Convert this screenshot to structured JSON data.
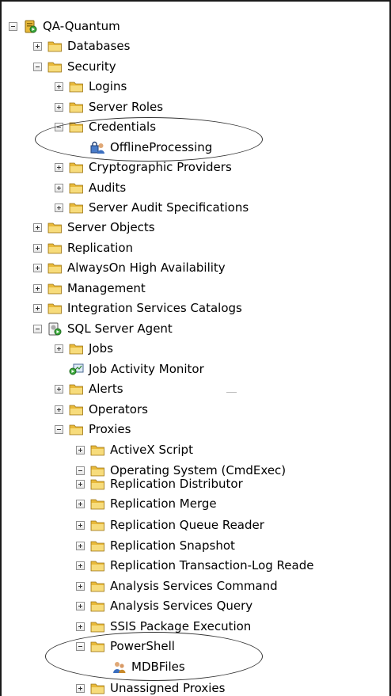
{
  "tree": {
    "root": {
      "label": "QA-Quantum",
      "icon": "server-icon",
      "expanded": true
    },
    "nodes": [
      {
        "id": "databases",
        "label": "Databases",
        "level": 1,
        "toggle": "plus",
        "icon": "folder-icon"
      },
      {
        "id": "security",
        "label": "Security",
        "level": 1,
        "toggle": "minus",
        "icon": "folder-icon"
      },
      {
        "id": "logins",
        "label": "Logins",
        "level": 2,
        "toggle": "plus",
        "icon": "folder-icon"
      },
      {
        "id": "server-roles",
        "label": "Server Roles",
        "level": 2,
        "toggle": "plus",
        "icon": "folder-icon"
      },
      {
        "id": "credentials",
        "label": "Credentials",
        "level": 2,
        "toggle": "minus",
        "icon": "folder-icon"
      },
      {
        "id": "offline-processing",
        "label": "OfflineProcessing",
        "level": 3,
        "toggle": "none",
        "icon": "credential-icon"
      },
      {
        "id": "cryptographic-providers",
        "label": "Cryptographic Providers",
        "level": 2,
        "toggle": "plus",
        "icon": "folder-icon"
      },
      {
        "id": "audits",
        "label": "Audits",
        "level": 2,
        "toggle": "plus",
        "icon": "folder-icon"
      },
      {
        "id": "server-audit-specifications",
        "label": "Server Audit Specifications",
        "level": 2,
        "toggle": "plus",
        "icon": "folder-icon"
      },
      {
        "id": "server-objects",
        "label": "Server Objects",
        "level": 1,
        "toggle": "plus",
        "icon": "folder-icon"
      },
      {
        "id": "replication",
        "label": "Replication",
        "level": 1,
        "toggle": "plus",
        "icon": "folder-icon"
      },
      {
        "id": "alwayson",
        "label": "AlwaysOn High Availability",
        "level": 1,
        "toggle": "plus",
        "icon": "folder-icon"
      },
      {
        "id": "management",
        "label": "Management",
        "level": 1,
        "toggle": "plus",
        "icon": "folder-icon"
      },
      {
        "id": "integration-services-catalogs",
        "label": "Integration Services Catalogs",
        "level": 1,
        "toggle": "plus",
        "icon": "folder-icon"
      },
      {
        "id": "sql-server-agent",
        "label": "SQL Server Agent",
        "level": 1,
        "toggle": "minus",
        "icon": "agent-icon"
      },
      {
        "id": "jobs",
        "label": "Jobs",
        "level": 2,
        "toggle": "plus",
        "icon": "folder-icon"
      },
      {
        "id": "job-activity-monitor",
        "label": "Job Activity Monitor",
        "level": 2,
        "toggle": "none",
        "icon": "monitor-icon"
      },
      {
        "id": "alerts",
        "label": "Alerts",
        "level": 2,
        "toggle": "plus",
        "icon": "folder-icon"
      },
      {
        "id": "operators",
        "label": "Operators",
        "level": 2,
        "toggle": "plus",
        "icon": "folder-icon"
      },
      {
        "id": "proxies",
        "label": "Proxies",
        "level": 2,
        "toggle": "minus",
        "icon": "folder-icon"
      },
      {
        "id": "activex-script",
        "label": "ActiveX Script",
        "level": 3,
        "toggle": "plus",
        "icon": "folder-icon"
      },
      {
        "id": "operating-system",
        "label": "Operating System (CmdExec)",
        "level": 3,
        "toggle": "minus",
        "icon": "folder-icon"
      },
      {
        "id": "replication-distributor",
        "label": "Replication Distributor",
        "level": 3,
        "toggle": "plus",
        "icon": "folder-icon"
      },
      {
        "id": "replication-merge",
        "label": "Replication Merge",
        "level": 3,
        "toggle": "plus",
        "icon": "folder-icon"
      },
      {
        "id": "replication-queue-reader",
        "label": "Replication Queue Reader",
        "level": 3,
        "toggle": "plus",
        "icon": "folder-icon"
      },
      {
        "id": "replication-snapshot",
        "label": "Replication Snapshot",
        "level": 3,
        "toggle": "plus",
        "icon": "folder-icon"
      },
      {
        "id": "replication-transaction-log-reader",
        "label": "Replication Transaction-Log Reade",
        "level": 3,
        "toggle": "plus",
        "icon": "folder-icon"
      },
      {
        "id": "analysis-services-command",
        "label": "Analysis Services Command",
        "level": 3,
        "toggle": "plus",
        "icon": "folder-icon"
      },
      {
        "id": "analysis-services-query",
        "label": "Analysis Services Query",
        "level": 3,
        "toggle": "plus",
        "icon": "folder-icon"
      },
      {
        "id": "ssis-package-execution",
        "label": "SSIS Package Execution",
        "level": 3,
        "toggle": "plus",
        "icon": "folder-icon"
      },
      {
        "id": "powershell",
        "label": "PowerShell",
        "level": 3,
        "toggle": "minus",
        "icon": "folder-icon"
      },
      {
        "id": "mdbfiles",
        "label": "MDBFiles",
        "level": 4,
        "toggle": "none",
        "icon": "proxy-account-icon"
      },
      {
        "id": "unassigned-proxies",
        "label": "Unassigned Proxies",
        "level": 3,
        "toggle": "plus",
        "icon": "folder-icon"
      }
    ]
  },
  "colors": {
    "folder": "#e8b93a",
    "folder_light": "#f7dc7c",
    "border": "#1a1a1a",
    "highlight_ellipse": "#333333"
  }
}
